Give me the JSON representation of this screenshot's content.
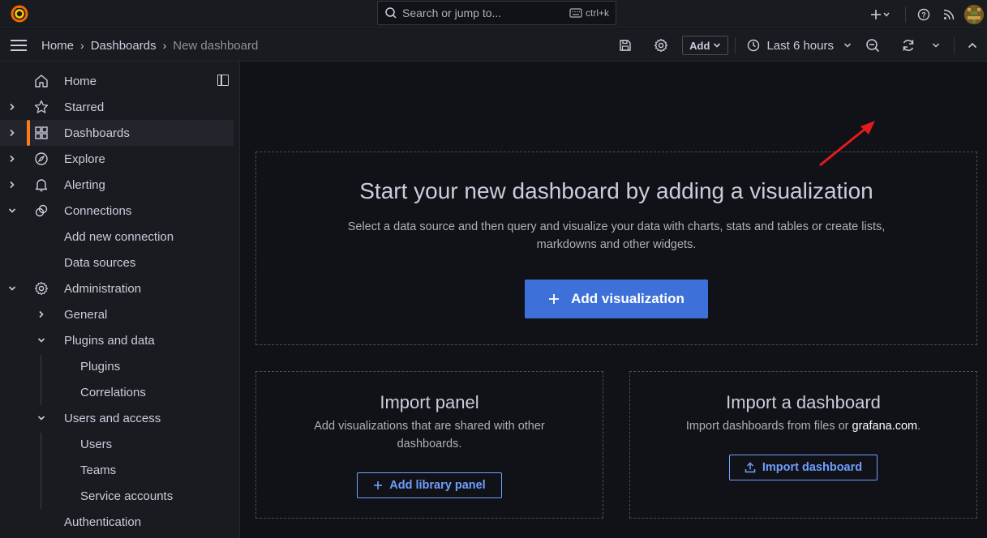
{
  "topbar": {
    "logo": "grafana-logo",
    "search_placeholder": "Search or jump to...",
    "search_shortcut": "ctrl+k",
    "plus_icon": "plus-icon",
    "help_icon": "help-icon",
    "news_icon": "rss-icon"
  },
  "breadcrumb": {
    "items": [
      "Home",
      "Dashboards",
      "New dashboard"
    ]
  },
  "toolbar": {
    "add_label": "Add",
    "time_range": "Last 6 hours"
  },
  "sidebar": {
    "items": [
      {
        "label": "Home",
        "icon": "home-icon",
        "chevron": ""
      },
      {
        "label": "Starred",
        "icon": "star-icon",
        "chevron": "right"
      },
      {
        "label": "Dashboards",
        "icon": "dashboards-icon",
        "chevron": "right",
        "active": true
      },
      {
        "label": "Explore",
        "icon": "compass-icon",
        "chevron": "right"
      },
      {
        "label": "Alerting",
        "icon": "bell-icon",
        "chevron": "right"
      },
      {
        "label": "Connections",
        "icon": "connections-icon",
        "chevron": "down"
      },
      {
        "label": "Add new connection"
      },
      {
        "label": "Data sources"
      },
      {
        "label": "Administration",
        "icon": "cog-icon",
        "chevron": "down"
      },
      {
        "label": "General",
        "chevron": "right"
      },
      {
        "label": "Plugins and data",
        "chevron": "down"
      },
      {
        "label": "Plugins"
      },
      {
        "label": "Correlations"
      },
      {
        "label": "Users and access",
        "chevron": "down"
      },
      {
        "label": "Users"
      },
      {
        "label": "Teams"
      },
      {
        "label": "Service accounts"
      },
      {
        "label": "Authentication"
      }
    ]
  },
  "hero": {
    "title": "Start your new dashboard by adding a visualization",
    "subtitle_line1": "Select a data source and then query and visualize your data with charts, stats and tables or create lists,",
    "subtitle_line2": "markdowns and other widgets.",
    "button": "Add visualization"
  },
  "import_panel": {
    "title": "Import panel",
    "text_line1": "Add visualizations that are shared with other",
    "text_line2": "dashboards.",
    "button": "Add library panel"
  },
  "import_dashboard": {
    "title": "Import a dashboard",
    "text": "Import dashboards from files or ",
    "link": "grafana.com",
    "text_end": ".",
    "button": "Import dashboard"
  },
  "colors": {
    "accent": "#3d71d9",
    "active_bar": "#ff7a18",
    "annotation_arrow": "#e31b1b"
  }
}
